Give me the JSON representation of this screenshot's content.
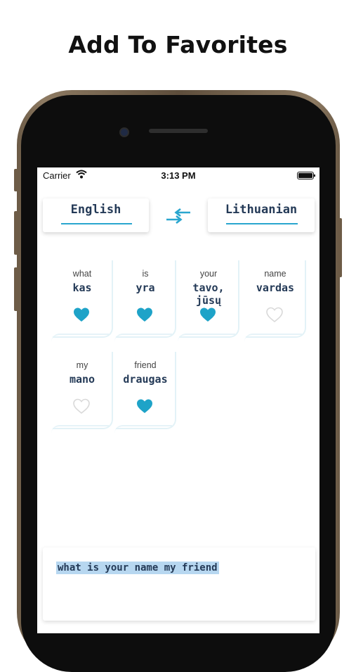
{
  "headline": "Add To Favorites",
  "status_bar": {
    "carrier": "Carrier",
    "time": "3:13 PM"
  },
  "languages": {
    "source": "English",
    "target": "Lithuanian"
  },
  "words": [
    {
      "english": "what",
      "lithuanian": "kas",
      "favorite": true
    },
    {
      "english": "is",
      "lithuanian": "yra",
      "favorite": true
    },
    {
      "english": "your",
      "lithuanian": "tavo, jūsų",
      "favorite": true
    },
    {
      "english": "name",
      "lithuanian": "vardas",
      "favorite": false
    },
    {
      "english": "my",
      "lithuanian": "mano",
      "favorite": false
    },
    {
      "english": "friend",
      "lithuanian": "draugas",
      "favorite": true
    }
  ],
  "input_text": "what is your name my friend",
  "colors": {
    "accent": "#2aa6cf",
    "heart_filled": "#1ea3c8",
    "heart_empty": "#d9d9d9",
    "text_dark": "#243a57"
  },
  "icons": {
    "swap": "swap-arrows-icon",
    "favorite": "heart-icon",
    "wifi": "wifi-icon",
    "battery": "battery-icon"
  }
}
